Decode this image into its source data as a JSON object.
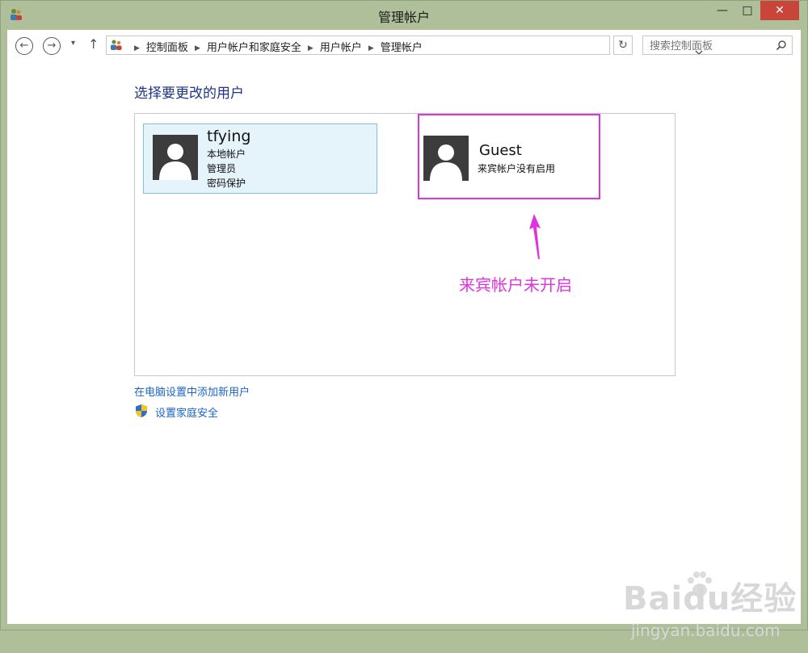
{
  "window": {
    "title": "管理帐户",
    "controls": {
      "minimize": "—",
      "maximize": "□",
      "close": "✕"
    }
  },
  "nav": {
    "back_icon": "←",
    "forward_icon": "→",
    "recent_icon": "▾",
    "up_icon": "↑",
    "breadcrumbs": [
      "控制面板",
      "用户帐户和家庭安全",
      "用户帐户",
      "管理帐户"
    ],
    "refresh_icon": "↻",
    "search_placeholder": "搜索控制面板"
  },
  "main": {
    "heading": "选择要更改的用户",
    "accounts": [
      {
        "name": "tfying",
        "details": [
          "本地帐户",
          "管理员",
          "密码保护"
        ]
      },
      {
        "name": "Guest",
        "details": [
          "来宾帐户没有启用"
        ]
      }
    ],
    "annotation": {
      "text": "来宾帐户未开启",
      "color": "#e033e0"
    },
    "links": {
      "add_user": "在电脑设置中添加新用户",
      "family_safety": "设置家庭安全"
    }
  },
  "watermark": {
    "logo": "Baidu经验",
    "url": "jingyan.baidu.com"
  }
}
